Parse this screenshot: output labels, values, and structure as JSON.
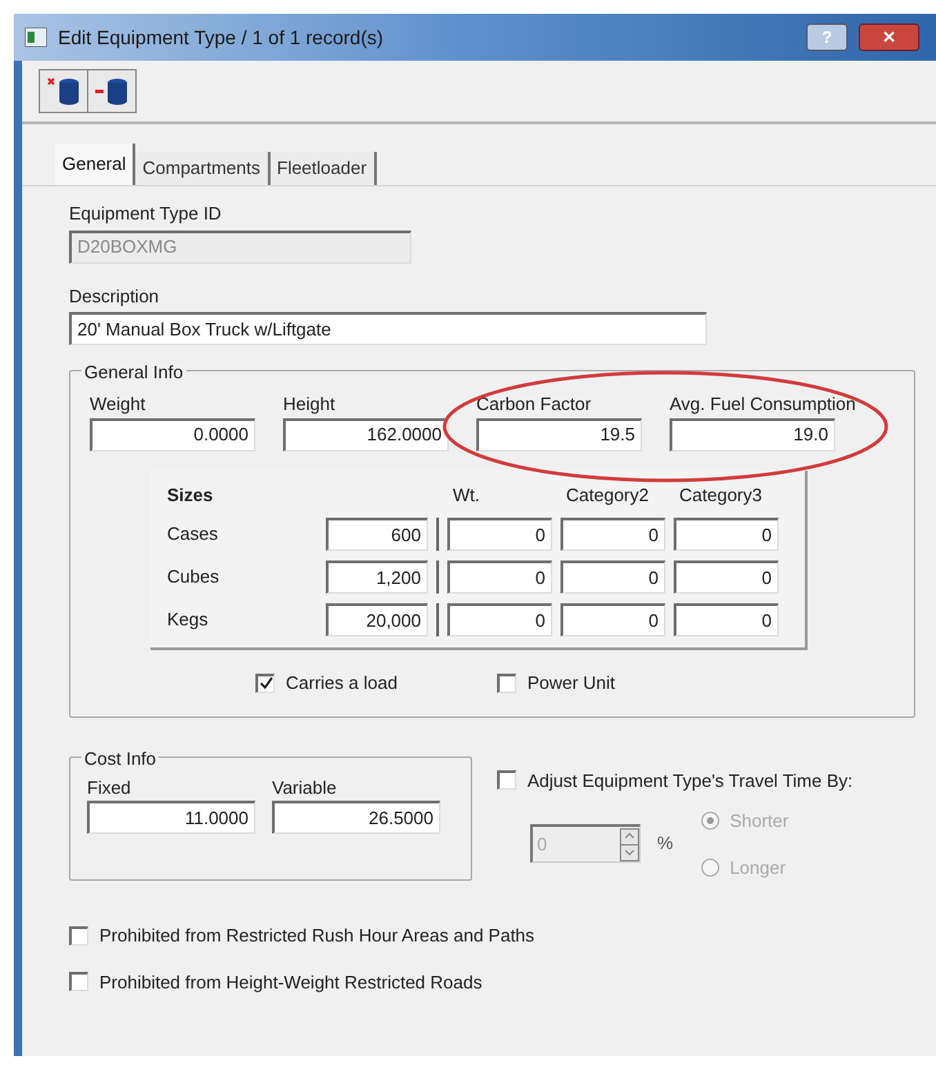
{
  "window": {
    "title": "Edit Equipment Type / 1 of 1 record(s)",
    "help_button": "?",
    "close_button": "✕"
  },
  "tabs": [
    {
      "label": "General",
      "selected": true
    },
    {
      "label": "Compartments",
      "selected": false
    },
    {
      "label": "Fleetloader",
      "selected": false
    }
  ],
  "equipment_type_id": {
    "label": "Equipment Type ID",
    "value": "D20BOXMG",
    "disabled": true
  },
  "description": {
    "label": "Description",
    "value": "20' Manual Box Truck w/Liftgate"
  },
  "general_info": {
    "title": "General Info",
    "fields": [
      {
        "label": "Weight",
        "value": "0.0000"
      },
      {
        "label": "Height",
        "value": "162.0000"
      },
      {
        "label": "Carbon Factor",
        "value": "19.5"
      },
      {
        "label": "Avg. Fuel Consumption",
        "value": "19.0"
      }
    ],
    "annotation": {
      "kind": "ellipse"
    },
    "sizes": {
      "title": "Sizes",
      "columns": [
        "Wt.",
        "Category2",
        "Category3"
      ],
      "rows": [
        {
          "label": "Cases",
          "values": [
            "600",
            "0",
            "0",
            "0"
          ]
        },
        {
          "label": "Cubes",
          "values": [
            "1,200",
            "0",
            "0",
            "0"
          ]
        },
        {
          "label": "Kegs",
          "values": [
            "20,000",
            "0",
            "0",
            "0"
          ]
        }
      ]
    },
    "checkboxes": [
      {
        "label": "Carries a load",
        "checked": true
      },
      {
        "label": "Power Unit",
        "checked": false
      }
    ]
  },
  "cost_info": {
    "title": "Cost Info",
    "fields": [
      {
        "label": "Fixed",
        "value": "11.0000"
      },
      {
        "label": "Variable",
        "value": "26.5000"
      }
    ]
  },
  "travel_time": {
    "label": "Adjust Equipment Type's Travel Time By:",
    "checked": false,
    "disabled": true,
    "value": "0",
    "unit": "%",
    "options": [
      {
        "label": "Shorter",
        "selected": true
      },
      {
        "label": "Longer",
        "selected": false
      }
    ]
  },
  "restrictions": [
    {
      "label": "Prohibited from Restricted Rush Hour Areas and Paths",
      "checked": false
    },
    {
      "label": "Prohibited from Height-Weight Restricted Roads",
      "checked": false
    }
  ]
}
